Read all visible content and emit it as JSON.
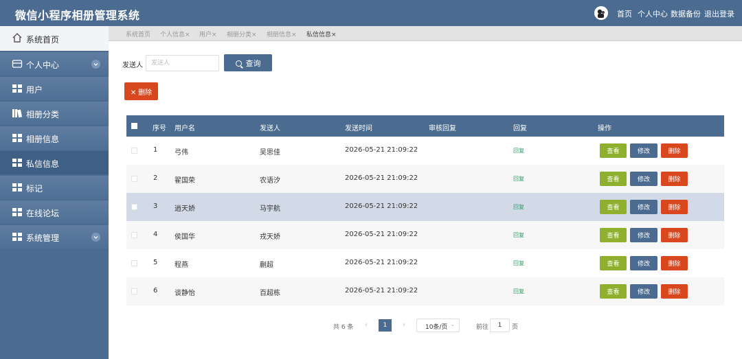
{
  "header": {
    "title": "微信小程序相册管理系统",
    "links": [
      "首页",
      "个人中心",
      "数据备份",
      "退出登录"
    ]
  },
  "sidebar": {
    "items": [
      {
        "label": "系统首页",
        "icon": "home-icon"
      },
      {
        "label": "个人中心",
        "icon": "user-center-icon",
        "expandable": true
      },
      {
        "label": "用户",
        "icon": "grid-icon"
      },
      {
        "label": "相册分类",
        "icon": "book-icon"
      },
      {
        "label": "相册信息",
        "icon": "grid-icon"
      },
      {
        "label": "私信信息",
        "icon": "grid-icon",
        "active": true
      },
      {
        "label": "标记",
        "icon": "grid-icon"
      },
      {
        "label": "在线论坛",
        "icon": "grid-icon"
      },
      {
        "label": "系统管理",
        "icon": "grid-icon",
        "expandable": true
      }
    ]
  },
  "tabs": [
    {
      "label": "系统首页",
      "closable": false
    },
    {
      "label": "个人信息",
      "closable": true
    },
    {
      "label": "用户",
      "closable": true
    },
    {
      "label": "相册分类",
      "closable": true
    },
    {
      "label": "相册信息",
      "closable": true
    },
    {
      "label": "私信信息",
      "closable": true,
      "active": true
    }
  ],
  "search": {
    "label": "发送人",
    "placeholder": "发送人",
    "button_label": "查询"
  },
  "toolbar": {
    "delete_label": "删除"
  },
  "table": {
    "columns": [
      "序号",
      "用户名",
      "发送人",
      "发送时间",
      "审核回复",
      "回复",
      "操作"
    ],
    "rows": [
      {
        "index": "1",
        "username": "弓伟",
        "sender": "吴思佳",
        "time": "2026-05-21 21:09:22",
        "review": "",
        "reply": "回复"
      },
      {
        "index": "2",
        "username": "翟国荣",
        "sender": "农语汐",
        "time": "2026-05-21 21:09:22",
        "review": "",
        "reply": "回复"
      },
      {
        "index": "3",
        "username": "逍天娇",
        "sender": "马宇航",
        "time": "2026-05-21 21:09:22",
        "review": "",
        "reply": "回复"
      },
      {
        "index": "4",
        "username": "侯国华",
        "sender": "戎天娇",
        "time": "2026-05-21 21:09:22",
        "review": "",
        "reply": "回复"
      },
      {
        "index": "5",
        "username": "程燕",
        "sender": "蒯超",
        "time": "2026-05-21 21:09:22",
        "review": "",
        "reply": "回复"
      },
      {
        "index": "6",
        "username": "谈静怡",
        "sender": "百超栋",
        "time": "2026-05-21 21:09:22",
        "review": "",
        "reply": "回复"
      }
    ],
    "actions": {
      "view": "查看",
      "edit": "修改",
      "delete": "删除"
    }
  },
  "pagination": {
    "total": "共 6 条",
    "prev": "‹",
    "current_page": "1",
    "next": "›",
    "page_size": "10条/页",
    "goto_label": "前往",
    "goto_value": "1",
    "page_suffix": "页"
  },
  "colors": {
    "primary": "#4b6b90",
    "danger": "#d9471e",
    "success": "#8fb02e",
    "row_highlight": "#d1dae6"
  }
}
